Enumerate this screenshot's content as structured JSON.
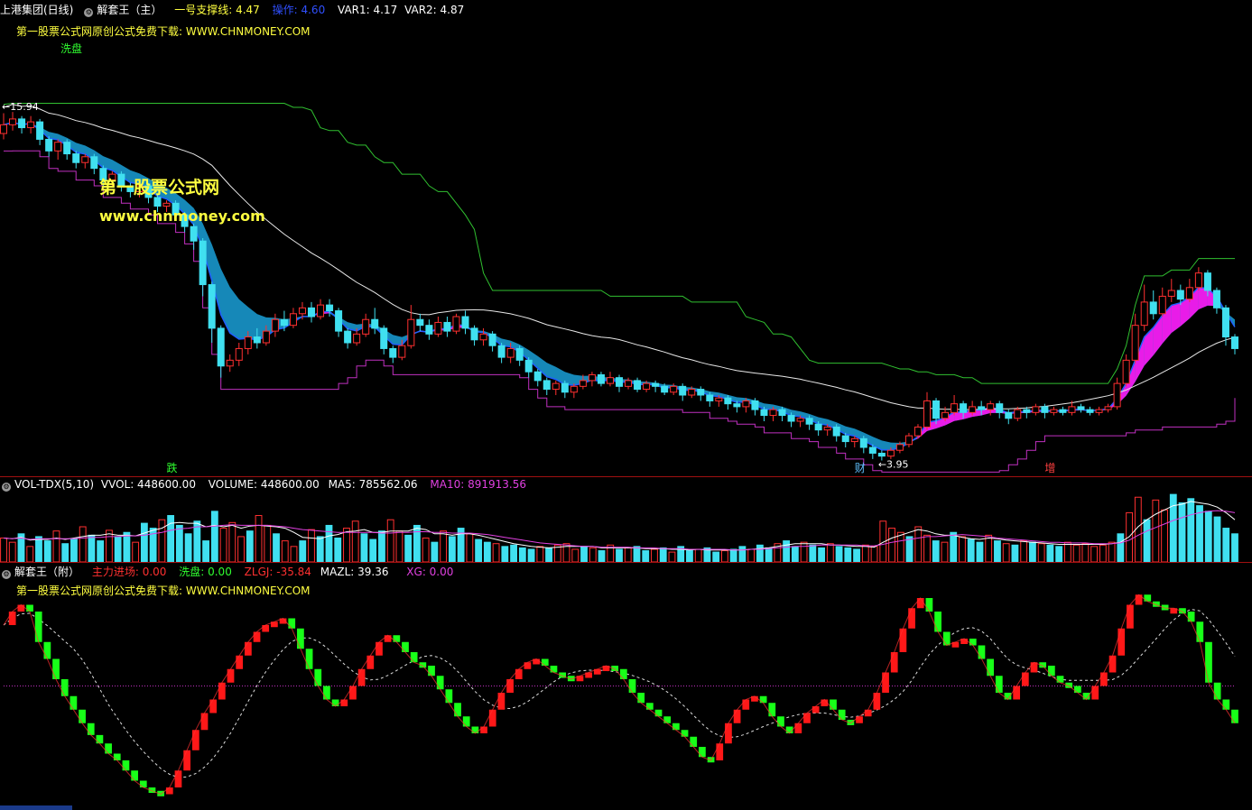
{
  "header": {
    "security": "上港集团(日线)",
    "indicator": "解套王（主）",
    "support_label": "一号支撑线: 4.47",
    "op_label": "操作: 4.60",
    "var1_label": "VAR1: 4.17",
    "var2_label": "VAR2: 4.87",
    "promo": "第一股票公式网原创公式免费下载: WWW.CHNMONEY.COM",
    "wash": "洗盘"
  },
  "watermark": {
    "cn": "第一股票公式网",
    "url": "www.chnmoney.com"
  },
  "price_labels": {
    "high": "15.94",
    "low": "3.95"
  },
  "bottom_flags": [
    "跌",
    "财",
    "增"
  ],
  "vol_header": {
    "name": "VOL-TDX(5,10)",
    "vvol": "VVOL: 448600.00",
    "volume": "VOLUME: 448600.00",
    "ma5": "MA5: 785562.06",
    "ma10": "MA10: 891913.56"
  },
  "sub_header": {
    "name": "解套王（附）",
    "main": "主力进场: 0.00",
    "wash": "洗盘: 0.00",
    "zlgj": "ZLGJ: -35.84",
    "mazl": "MAZL: 39.36",
    "xg": "XG: 0.00",
    "promo": "第一股票公式网原创公式免费下载: WWW.CHNMONEY.COM"
  },
  "colors": {
    "up": "#ff3030",
    "down": "#40e0f0",
    "band": "#1aa0d8",
    "band_inner": "#e81ce8",
    "ma_white": "#e8e8e8",
    "resist_green": "#30c030",
    "support_magenta": "#c030c0",
    "label_yellow": "#ffff40",
    "label_white": "#ffffff",
    "osc_red": "#ff1818",
    "osc_green": "#18ff18"
  },
  "chart_data": [
    {
      "type": "candlestick",
      "title": "",
      "ylim": [
        3.5,
        17
      ],
      "candles": [
        [
          15.2,
          15.5,
          15.9,
          15.0
        ],
        [
          15.5,
          15.7,
          15.94,
          15.3
        ],
        [
          15.7,
          15.4,
          15.8,
          15.2
        ],
        [
          15.4,
          15.6,
          15.8,
          15.2
        ],
        [
          15.6,
          15.0,
          15.7,
          14.8
        ],
        [
          15.0,
          14.6,
          15.1,
          14.4
        ],
        [
          14.6,
          14.9,
          15.0,
          14.3
        ],
        [
          14.9,
          14.5,
          15.0,
          14.3
        ],
        [
          14.5,
          14.2,
          14.6,
          14.0
        ],
        [
          14.2,
          14.4,
          14.5,
          14.0
        ],
        [
          14.4,
          14.0,
          14.5,
          13.8
        ],
        [
          14.0,
          13.6,
          14.1,
          13.4
        ],
        [
          13.6,
          13.8,
          13.9,
          13.4
        ],
        [
          13.8,
          13.4,
          13.9,
          13.2
        ],
        [
          13.4,
          13.2,
          13.5,
          13.0
        ],
        [
          13.2,
          13.4,
          13.5,
          13.0
        ],
        [
          13.4,
          13.0,
          13.5,
          12.8
        ],
        [
          13.0,
          12.7,
          13.1,
          12.5
        ],
        [
          12.7,
          12.8,
          12.9,
          12.5
        ],
        [
          12.8,
          12.4,
          12.9,
          12.2
        ],
        [
          12.4,
          12.0,
          12.5,
          11.8
        ],
        [
          12.0,
          11.5,
          12.1,
          11.2
        ],
        [
          11.5,
          10.0,
          11.6,
          9.6
        ],
        [
          10.0,
          8.5,
          10.1,
          8.0
        ],
        [
          8.5,
          7.2,
          8.6,
          6.8
        ],
        [
          7.2,
          7.4,
          7.6,
          7.0
        ],
        [
          7.4,
          7.8,
          8.0,
          7.2
        ],
        [
          7.8,
          8.2,
          8.4,
          7.6
        ],
        [
          8.2,
          8.0,
          8.5,
          7.8
        ],
        [
          8.0,
          8.4,
          8.6,
          7.9
        ],
        [
          8.4,
          8.8,
          9.0,
          8.2
        ],
        [
          8.8,
          8.6,
          9.1,
          8.4
        ],
        [
          8.6,
          9.0,
          9.2,
          8.5
        ],
        [
          9.0,
          9.2,
          9.4,
          8.8
        ],
        [
          9.2,
          8.9,
          9.4,
          8.7
        ],
        [
          8.9,
          9.3,
          9.5,
          8.8
        ],
        [
          9.3,
          9.1,
          9.5,
          8.9
        ],
        [
          9.1,
          8.4,
          9.2,
          8.2
        ],
        [
          8.4,
          8.0,
          8.5,
          7.8
        ],
        [
          8.0,
          8.3,
          8.5,
          7.9
        ],
        [
          8.3,
          8.8,
          9.0,
          8.2
        ],
        [
          8.8,
          8.5,
          9.2,
          8.3
        ],
        [
          8.5,
          7.8,
          8.6,
          7.6
        ],
        [
          7.8,
          7.5,
          7.9,
          7.3
        ],
        [
          7.5,
          7.9,
          8.1,
          7.4
        ],
        [
          7.9,
          8.8,
          9.3,
          7.8
        ],
        [
          8.8,
          8.6,
          9.0,
          8.4
        ],
        [
          8.6,
          8.3,
          8.8,
          8.1
        ],
        [
          8.3,
          8.7,
          8.9,
          8.2
        ],
        [
          8.7,
          8.4,
          8.9,
          8.2
        ],
        [
          8.4,
          8.9,
          9.0,
          8.3
        ],
        [
          8.9,
          8.5,
          9.1,
          8.3
        ],
        [
          8.5,
          8.1,
          8.6,
          7.9
        ],
        [
          8.1,
          8.3,
          8.5,
          7.9
        ],
        [
          8.3,
          7.9,
          8.4,
          7.7
        ],
        [
          7.9,
          7.5,
          8.0,
          7.3
        ],
        [
          7.5,
          7.8,
          8.0,
          7.3
        ],
        [
          7.8,
          7.4,
          7.9,
          7.2
        ],
        [
          7.4,
          7.0,
          7.5,
          6.8
        ],
        [
          7.0,
          6.7,
          7.1,
          6.5
        ],
        [
          6.7,
          6.4,
          6.8,
          6.2
        ],
        [
          6.4,
          6.6,
          6.7,
          6.2
        ],
        [
          6.6,
          6.3,
          6.7,
          6.1
        ],
        [
          6.3,
          6.5,
          6.6,
          6.1
        ],
        [
          6.5,
          6.7,
          6.9,
          6.4
        ],
        [
          6.7,
          6.9,
          7.0,
          6.5
        ],
        [
          6.9,
          6.6,
          7.0,
          6.5
        ],
        [
          6.6,
          6.8,
          7.0,
          6.5
        ],
        [
          6.8,
          6.5,
          6.9,
          6.3
        ],
        [
          6.5,
          6.7,
          6.8,
          6.4
        ],
        [
          6.7,
          6.4,
          6.8,
          6.3
        ],
        [
          6.4,
          6.6,
          6.7,
          6.3
        ],
        [
          6.6,
          6.5,
          6.7,
          6.3
        ],
        [
          6.5,
          6.3,
          6.6,
          6.2
        ],
        [
          6.3,
          6.5,
          6.6,
          6.2
        ],
        [
          6.5,
          6.2,
          6.6,
          6.0
        ],
        [
          6.2,
          6.4,
          6.5,
          6.1
        ],
        [
          6.4,
          6.2,
          6.5,
          6.0
        ],
        [
          6.2,
          6.0,
          6.3,
          5.8
        ],
        [
          6.0,
          6.1,
          6.2,
          5.8
        ],
        [
          6.1,
          5.9,
          6.2,
          5.7
        ],
        [
          5.9,
          5.8,
          6.0,
          5.6
        ],
        [
          5.8,
          6.0,
          6.1,
          5.6
        ],
        [
          6.0,
          5.7,
          6.1,
          5.5
        ],
        [
          5.7,
          5.5,
          5.8,
          5.3
        ],
        [
          5.5,
          5.7,
          5.8,
          5.3
        ],
        [
          5.7,
          5.5,
          5.8,
          5.3
        ],
        [
          5.5,
          5.3,
          5.6,
          5.1
        ],
        [
          5.3,
          5.4,
          5.5,
          5.1
        ],
        [
          5.4,
          5.2,
          5.5,
          5.0
        ],
        [
          5.2,
          5.0,
          5.3,
          4.8
        ],
        [
          5.0,
          5.1,
          5.2,
          4.8
        ],
        [
          5.1,
          4.8,
          5.2,
          4.6
        ],
        [
          4.8,
          4.6,
          4.9,
          4.4
        ],
        [
          4.6,
          4.7,
          4.8,
          4.4
        ],
        [
          4.7,
          4.4,
          4.8,
          4.2
        ],
        [
          4.4,
          4.2,
          4.5,
          4.0
        ],
        [
          4.2,
          4.1,
          4.3,
          3.95
        ],
        [
          4.1,
          4.3,
          4.4,
          4.0
        ],
        [
          4.3,
          4.5,
          4.6,
          4.2
        ],
        [
          4.5,
          4.8,
          4.9,
          4.4
        ],
        [
          4.8,
          5.1,
          5.2,
          4.7
        ],
        [
          5.1,
          6.0,
          6.3,
          5.0
        ],
        [
          6.0,
          5.4,
          6.1,
          5.2
        ],
        [
          5.4,
          5.6,
          5.8,
          5.3
        ],
        [
          5.6,
          5.9,
          6.2,
          5.5
        ],
        [
          5.9,
          5.6,
          6.0,
          5.4
        ],
        [
          5.6,
          5.8,
          6.0,
          5.5
        ],
        [
          5.8,
          5.7,
          6.0,
          5.5
        ],
        [
          5.7,
          5.9,
          6.0,
          5.5
        ],
        [
          5.9,
          5.6,
          6.0,
          5.4
        ],
        [
          5.6,
          5.4,
          5.7,
          5.2
        ],
        [
          5.4,
          5.7,
          5.8,
          5.3
        ],
        [
          5.7,
          5.6,
          5.8,
          5.4
        ],
        [
          5.6,
          5.8,
          5.9,
          5.5
        ],
        [
          5.8,
          5.6,
          5.9,
          5.4
        ],
        [
          5.6,
          5.7,
          5.8,
          5.5
        ],
        [
          5.7,
          5.6,
          5.8,
          5.5
        ],
        [
          5.6,
          5.8,
          6.0,
          5.5
        ],
        [
          5.8,
          5.7,
          5.9,
          5.6
        ],
        [
          5.7,
          5.6,
          5.8,
          5.5
        ],
        [
          5.6,
          5.7,
          5.8,
          5.5
        ],
        [
          5.7,
          5.8,
          5.9,
          5.6
        ],
        [
          5.8,
          6.6,
          6.8,
          5.7
        ],
        [
          6.6,
          7.4,
          7.6,
          6.5
        ],
        [
          7.4,
          8.6,
          9.0,
          7.3
        ],
        [
          8.6,
          9.4,
          10.0,
          8.4
        ],
        [
          9.4,
          9.0,
          9.8,
          8.8
        ],
        [
          9.0,
          9.6,
          9.9,
          8.9
        ],
        [
          9.6,
          9.8,
          10.2,
          9.4
        ],
        [
          9.8,
          9.5,
          10.0,
          9.3
        ],
        [
          9.5,
          9.9,
          10.2,
          9.4
        ],
        [
          9.9,
          10.4,
          10.6,
          9.8
        ],
        [
          10.4,
          9.8,
          10.5,
          9.6
        ],
        [
          9.8,
          9.2,
          9.9,
          9.0
        ],
        [
          9.2,
          8.2,
          9.3,
          7.9
        ],
        [
          8.2,
          7.8,
          8.3,
          7.6
        ]
      ],
      "series": [
        {
          "name": "一号支撑线"
        },
        {
          "name": "VAR1"
        },
        {
          "name": "VAR2"
        }
      ]
    },
    {
      "type": "bar",
      "title": "VOL-TDX(5,10)",
      "volumes": [
        34,
        28,
        40,
        22,
        36,
        30,
        44,
        26,
        32,
        50,
        38,
        30,
        45,
        36,
        42,
        28,
        55,
        48,
        60,
        66,
        52,
        40,
        58,
        30,
        72,
        48,
        56,
        36,
        44,
        66,
        52,
        40,
        30,
        22,
        30,
        46,
        36,
        52,
        34,
        48,
        58,
        40,
        32,
        44,
        60,
        44,
        38,
        52,
        34,
        28,
        44,
        36,
        48,
        40,
        32,
        28,
        26,
        22,
        24,
        20,
        18,
        22,
        20,
        24,
        26,
        18,
        22,
        20,
        16,
        24,
        18,
        20,
        22,
        16,
        18,
        20,
        14,
        22,
        16,
        18,
        20,
        14,
        16,
        18,
        22,
        18,
        24,
        20,
        26,
        30,
        22,
        28,
        24,
        20,
        26,
        22,
        20,
        18,
        24,
        22,
        58,
        48,
        42,
        36,
        50,
        38,
        30,
        28,
        42,
        36,
        32,
        28,
        38,
        30,
        26,
        24,
        30,
        28,
        26,
        24,
        22,
        28,
        24,
        26,
        22,
        24,
        28,
        40,
        70,
        92,
        60,
        88,
        74,
        96,
        84,
        90,
        80,
        72,
        64,
        48,
        40
      ],
      "ma5": [
        34,
        33,
        35,
        31,
        32,
        32,
        34,
        32,
        34,
        36,
        38,
        38,
        40,
        38,
        38,
        37,
        41,
        45,
        48,
        55,
        56,
        55,
        55,
        50,
        52,
        50,
        52,
        48,
        51,
        52,
        51,
        50,
        48,
        42,
        35,
        34,
        33,
        37,
        39,
        43,
        44,
        46,
        42,
        42,
        44,
        44,
        44,
        48,
        46,
        40,
        40,
        38,
        40,
        40,
        38,
        35,
        32,
        29,
        26,
        24,
        22,
        21,
        20,
        21,
        22,
        22,
        22,
        22,
        20,
        20,
        20,
        20,
        20,
        19,
        19,
        19,
        18,
        18,
        17,
        18,
        17,
        17,
        17,
        17,
        17,
        18,
        19,
        20,
        22,
        24,
        26,
        26,
        26,
        26,
        24,
        24,
        23,
        22,
        22,
        21,
        28,
        34,
        38,
        42,
        46,
        44,
        40,
        38,
        38,
        35,
        33,
        32,
        34,
        33,
        31,
        30,
        29,
        28,
        27,
        26,
        25,
        25,
        25,
        25,
        25,
        25,
        26,
        28,
        36,
        50,
        60,
        68,
        74,
        80,
        82,
        86,
        84,
        82,
        78,
        70,
        60
      ],
      "ma10": [
        34,
        33,
        34,
        32,
        33,
        33,
        33,
        33,
        33,
        34,
        35,
        35,
        36,
        36,
        37,
        37,
        38,
        40,
        42,
        45,
        47,
        48,
        50,
        50,
        51,
        52,
        53,
        52,
        52,
        52,
        52,
        51,
        50,
        48,
        46,
        45,
        44,
        43,
        42,
        42,
        42,
        42,
        42,
        41,
        41,
        42,
        42,
        43,
        43,
        42,
        42,
        41,
        41,
        41,
        40,
        39,
        37,
        35,
        33,
        31,
        29,
        27,
        26,
        25,
        24,
        23,
        22,
        22,
        21,
        21,
        21,
        21,
        20,
        20,
        20,
        19,
        19,
        19,
        18,
        18,
        18,
        18,
        18,
        17,
        17,
        18,
        18,
        19,
        20,
        21,
        22,
        22,
        23,
        24,
        24,
        24,
        24,
        24,
        23,
        23,
        25,
        28,
        30,
        32,
        34,
        36,
        36,
        37,
        38,
        39,
        38,
        37,
        36,
        34,
        33,
        32,
        31,
        30,
        29,
        28,
        28,
        27,
        27,
        27,
        26,
        26,
        26,
        27,
        31,
        38,
        44,
        49,
        54,
        59,
        63,
        67,
        70,
        72,
        73,
        72,
        70
      ]
    },
    {
      "type": "bar",
      "title": "解套王（附）",
      "osc": [
        40,
        48,
        52,
        48,
        30,
        20,
        8,
        -2,
        -10,
        -18,
        -25,
        -30,
        -36,
        -40,
        -46,
        -52,
        -56,
        -58,
        -60,
        -56,
        -46,
        -34,
        -22,
        -12,
        -4,
        6,
        14,
        22,
        30,
        36,
        40,
        42,
        44,
        38,
        26,
        14,
        4,
        -4,
        -8,
        -4,
        4,
        14,
        22,
        30,
        34,
        30,
        24,
        18,
        16,
        10,
        2,
        -6,
        -14,
        -20,
        -24,
        -20,
        -10,
        0,
        8,
        14,
        18,
        20,
        16,
        12,
        10,
        8,
        10,
        12,
        14,
        16,
        14,
        8,
        0,
        -6,
        -10,
        -14,
        -18,
        -22,
        -26,
        -32,
        -38,
        -40,
        -30,
        -18,
        -10,
        -4,
        -2,
        -6,
        -14,
        -20,
        -24,
        -18,
        -12,
        -8,
        -4,
        -10,
        -16,
        -18,
        -14,
        -10,
        0,
        12,
        24,
        38,
        50,
        56,
        48,
        36,
        28,
        30,
        32,
        28,
        20,
        10,
        0,
        -4,
        4,
        12,
        18,
        16,
        10,
        6,
        4,
        0,
        -4,
        4,
        12,
        22,
        38,
        52,
        58,
        54,
        52,
        50,
        50,
        48,
        42,
        30,
        6,
        -4,
        -10,
        -18
      ]
    }
  ]
}
